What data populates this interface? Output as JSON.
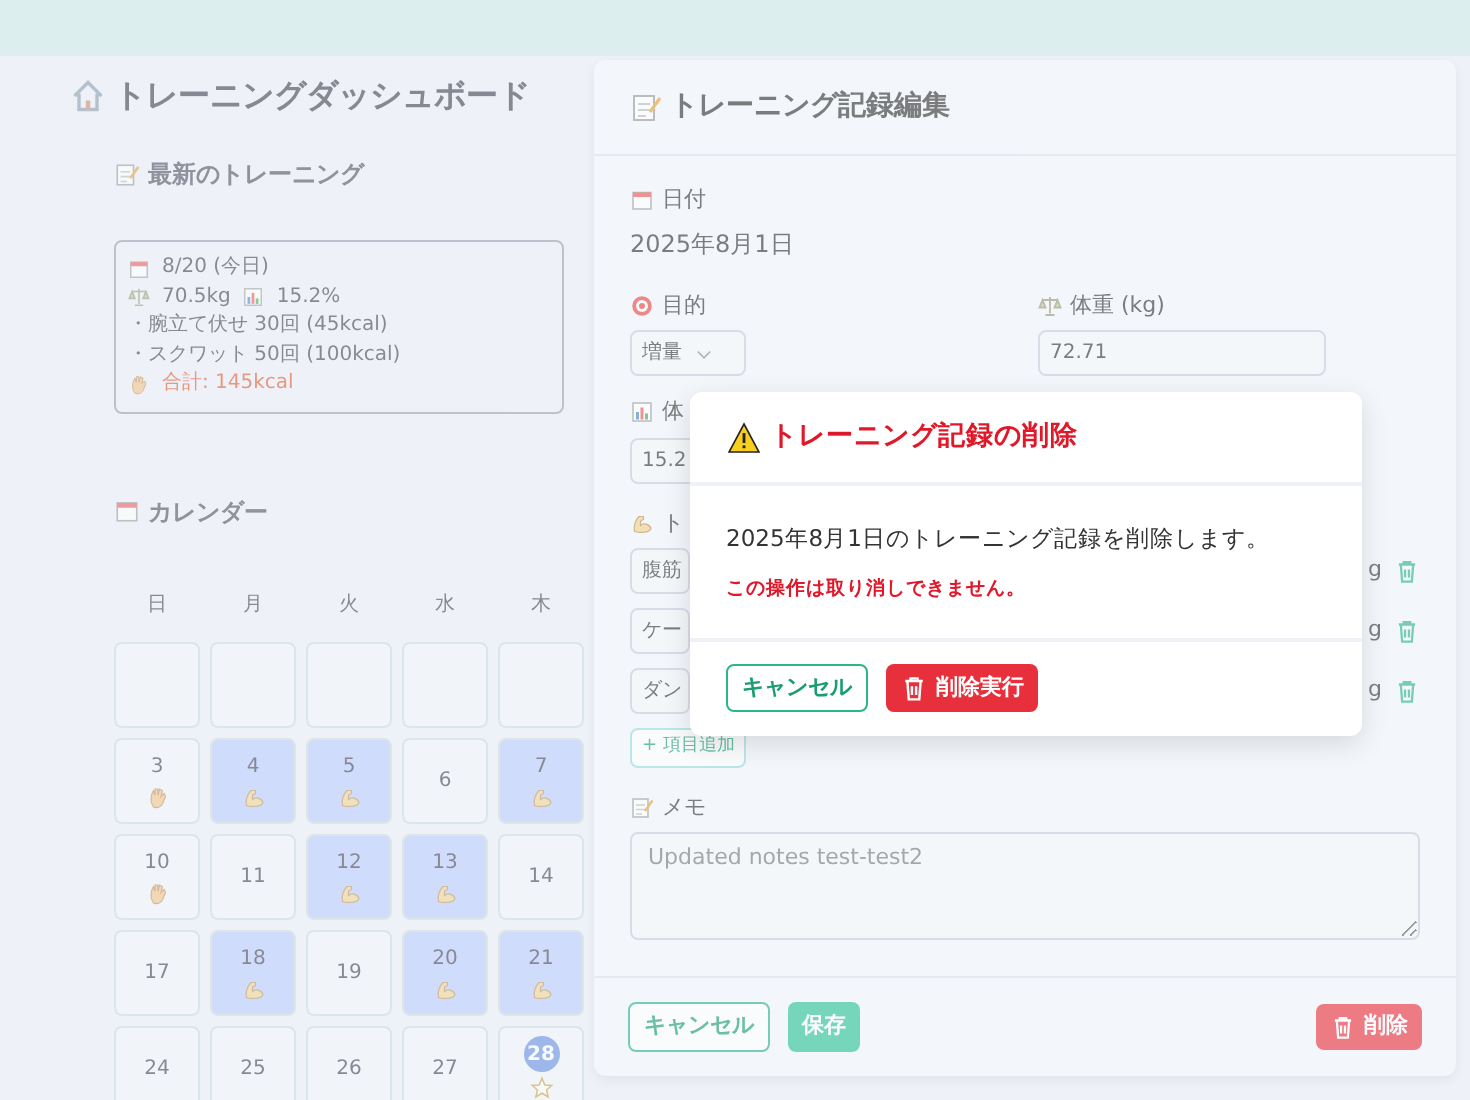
{
  "dashboard": {
    "title": "トレーニングダッシュボード",
    "latest": {
      "heading": "最新のトレーニング",
      "date": "8/20 (今日)",
      "weight": "70.5kg",
      "body_fat": "15.2%",
      "exercises": [
        "・腕立て伏せ 30回 (45kcal)",
        "・スクワット 50回 (100kcal)"
      ],
      "total": "合計: 145kcal"
    },
    "calendar": {
      "heading": "カレンダー",
      "weekdays": [
        "日",
        "月",
        "火",
        "水",
        "木"
      ],
      "weeks": [
        [
          {
            "kind": "empty"
          },
          {
            "kind": "empty"
          },
          {
            "kind": "empty"
          },
          {
            "kind": "empty"
          },
          {
            "kind": "empty"
          }
        ],
        [
          {
            "day": "3",
            "kind": "hand",
            "highlighted": false,
            "today": false
          },
          {
            "day": "4",
            "kind": "arm",
            "highlighted": true,
            "today": false
          },
          {
            "day": "5",
            "kind": "arm",
            "highlighted": true,
            "today": false
          },
          {
            "day": "6",
            "kind": "plain",
            "highlighted": false,
            "today": false
          },
          {
            "day": "7",
            "kind": "arm",
            "highlighted": true,
            "today": false
          }
        ],
        [
          {
            "day": "10",
            "kind": "hand",
            "highlighted": false,
            "today": false
          },
          {
            "day": "11",
            "kind": "plain",
            "highlighted": false,
            "today": false
          },
          {
            "day": "12",
            "kind": "arm",
            "highlighted": true,
            "today": false
          },
          {
            "day": "13",
            "kind": "arm",
            "highlighted": true,
            "today": false
          },
          {
            "day": "14",
            "kind": "plain",
            "highlighted": false,
            "today": false
          }
        ],
        [
          {
            "day": "17",
            "kind": "plain",
            "highlighted": false,
            "today": false
          },
          {
            "day": "18",
            "kind": "arm",
            "highlighted": true,
            "today": false
          },
          {
            "day": "19",
            "kind": "plain",
            "highlighted": false,
            "today": false
          },
          {
            "day": "20",
            "kind": "arm",
            "highlighted": true,
            "today": false
          },
          {
            "day": "21",
            "kind": "arm",
            "highlighted": true,
            "today": false
          }
        ],
        [
          {
            "day": "24",
            "kind": "plain",
            "highlighted": false,
            "today": false
          },
          {
            "day": "25",
            "kind": "plain",
            "highlighted": false,
            "today": false
          },
          {
            "day": "26",
            "kind": "plain",
            "highlighted": false,
            "today": false
          },
          {
            "day": "27",
            "kind": "plain",
            "highlighted": false,
            "today": false
          },
          {
            "day": "28",
            "kind": "star",
            "highlighted": false,
            "today": true
          }
        ]
      ]
    }
  },
  "edit_modal": {
    "title": "トレーニング記録編集",
    "date_label": "日付",
    "date_value": "2025年8月1日",
    "goal": {
      "label": "目的",
      "value": "増量"
    },
    "weight": {
      "label": "体重 (kg)",
      "value": "72.71"
    },
    "body_fat": {
      "label": "体",
      "value": "15.2"
    },
    "items": {
      "label": "ト",
      "rows": [
        {
          "name": "腹筋",
          "unit": "g"
        },
        {
          "name": "ケー",
          "unit": "g"
        },
        {
          "name": "ダン",
          "unit": "g"
        }
      ],
      "add_button": "+ 項目追加"
    },
    "memo": {
      "label": "メモ",
      "value": "Updated notes test-test2"
    },
    "buttons": {
      "cancel": "キャンセル",
      "save": "保存",
      "delete": "削除"
    }
  },
  "confirm_dialog": {
    "title": "トレーニング記録の削除",
    "message": "2025年8月1日のトレーニング記録を削除します。",
    "warning": "この操作は取り消しできません。",
    "buttons": {
      "cancel": "キャンセル",
      "confirm": "削除実行"
    }
  }
}
